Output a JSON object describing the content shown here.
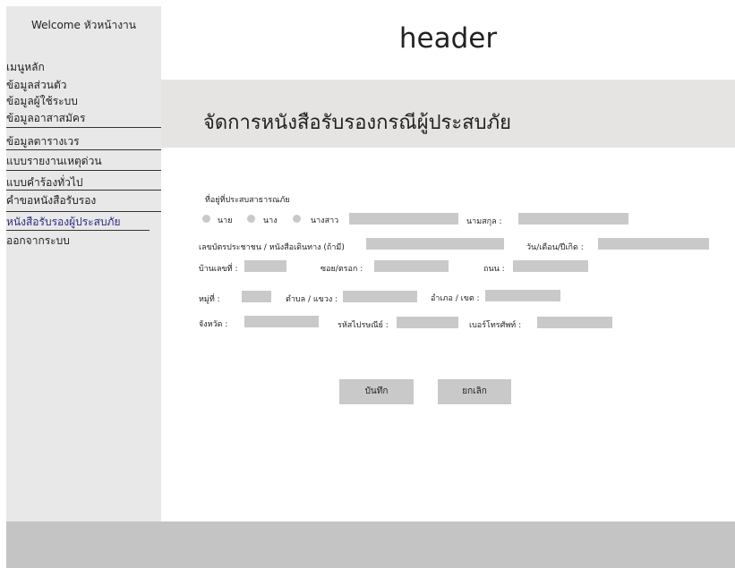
{
  "sidebar": {
    "welcome": "Welcome หัวหน้างาน",
    "items": [
      {
        "label": "เมนูหลัก"
      },
      {
        "label": "ข้อมูลส่วนตัว"
      },
      {
        "label": "ข้อมูลผู้ใช้ระบบ"
      },
      {
        "label": "ข้อมูลอาสาสมัคร"
      },
      {
        "label": "ข้อมูลตารางเวร"
      },
      {
        "label": "แบบรายงานเหตุด่วน"
      },
      {
        "label": "แบบคำร้องทั่วไป"
      },
      {
        "label": "คำขอหนังสือรับรอง"
      },
      {
        "label": "หนังสือรับรองผู้ประสบภัย"
      },
      {
        "label": "ออกจากระบบ"
      }
    ]
  },
  "header": {
    "title": "header"
  },
  "page": {
    "title": "จัดการหนังสือรับรองกรณีผู้ประสบภัย"
  },
  "form": {
    "section_label": "ที่อยู่ที่ประสบสาธารณภัย",
    "title_options": [
      "นาย",
      "นาง",
      "นางสาว"
    ],
    "surname_label": "นามสกุล :",
    "id_label": "เลขบัตรประชาชน / หนังสือเดินทาง (ถ้ามี)",
    "dob_label": "วัน/เดือน/ปีเกิด :",
    "house_no_label": "บ้านเลขที่ :",
    "soi_label": "ซอย/ตรอก :",
    "road_label": "ถนน :",
    "moo_label": "หมู่ที่ :",
    "tambon_label": "ตำบล / แขวง :",
    "amphoe_label": "อำเภอ / เขต :",
    "province_label": "จังหวัด :",
    "postcode_label": "รหัสไปรษณีย์ :",
    "phone_label": "เบอร์โทรศัพท์ :",
    "save_label": "บันทึก",
    "cancel_label": "ยกเลิก"
  },
  "colors": {
    "sidebar_bg": "#e8e8e8",
    "title_band_bg": "#e6e4e2",
    "field_bg": "#c9c9c9",
    "footer_bg": "#c4c4c4",
    "active_menu": "#2e2a82"
  }
}
